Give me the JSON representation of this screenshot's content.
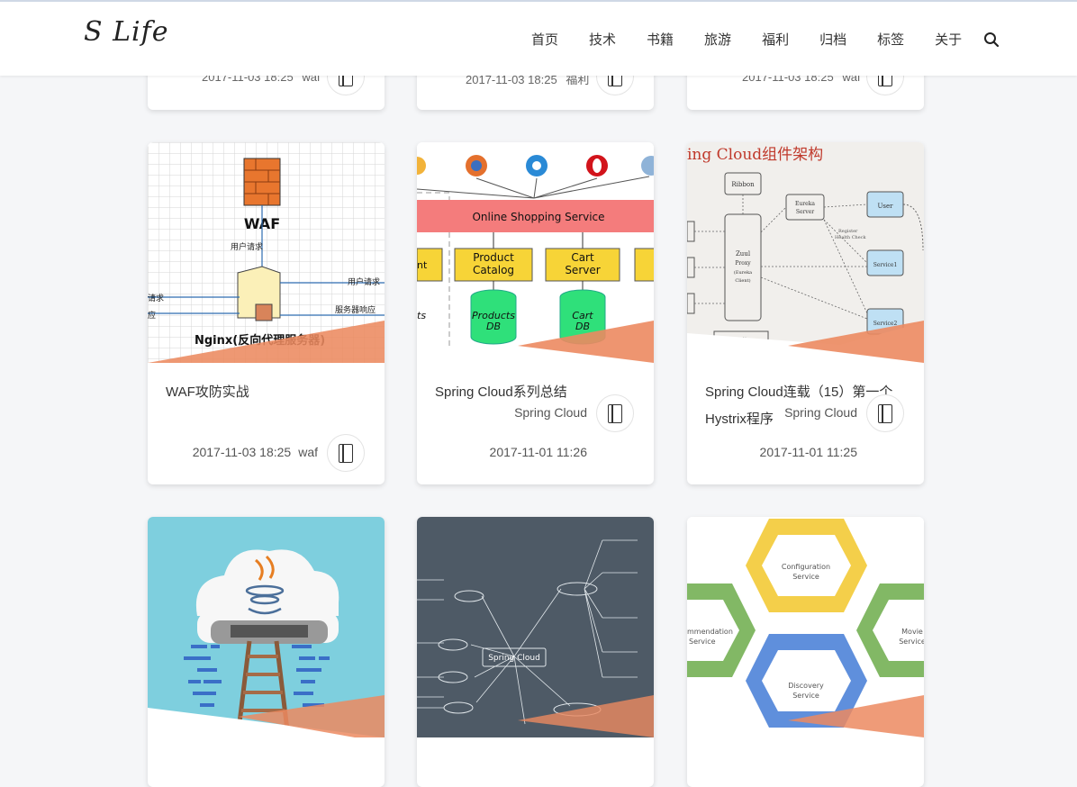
{
  "header": {
    "logo": "S Life",
    "nav": [
      "首页",
      "技术",
      "书籍",
      "旅游",
      "福利",
      "归档",
      "标签",
      "关于"
    ],
    "search_icon": "search-icon"
  },
  "top_row": [
    {
      "date": "2017-11-03 18:25",
      "author": "waf"
    },
    {
      "date": "2017-11-03 18:25",
      "author": "福利"
    },
    {
      "date": "2017-11-03 18:25",
      "author": "waf"
    }
  ],
  "posts": [
    {
      "title": "WAF攻防实战",
      "category": "",
      "date": "2017-11-03 18:25",
      "author": "waf"
    },
    {
      "title": "Spring Cloud系列总结",
      "category": "Spring Cloud",
      "date": "2017-11-01 11:26",
      "author": ""
    },
    {
      "title": "Spring Cloud连载（15）第一个Hystrix程序",
      "category": "Spring Cloud",
      "date": "2017-11-01 11:25",
      "author": ""
    }
  ],
  "thumbs": {
    "waf": {
      "title": "WAF",
      "label_req": "用户请求",
      "label_req2": "用户请求",
      "label_resp": "服务器响应",
      "left_a": "请求",
      "left_b": "应",
      "caption": "Nginx(反向代理服务器)"
    },
    "shop": {
      "service": "Online Shopping Service",
      "box1": "Product Catalog",
      "box2": "Cart Server",
      "box0": "nt e",
      "db1": "Products DB",
      "db2": "Cart DB",
      "db0": "ts"
    },
    "arch": {
      "title": "ing Cloud组件架构",
      "ribbon": "Ribbon",
      "eureka": "Eureka Server",
      "user": "User",
      "zuul": "Zuul Proxy (Eureka Client)",
      "register": "Register Health Check",
      "svc1": "Service1",
      "svc2": "Service2",
      "monitor": "Monitor"
    },
    "mind": {
      "center": "Spring Cloud"
    },
    "hex": {
      "config": "Configuration Service",
      "discovery": "Discovery Service",
      "movie": "Movie Service",
      "rec": "mmendation Service"
    }
  }
}
